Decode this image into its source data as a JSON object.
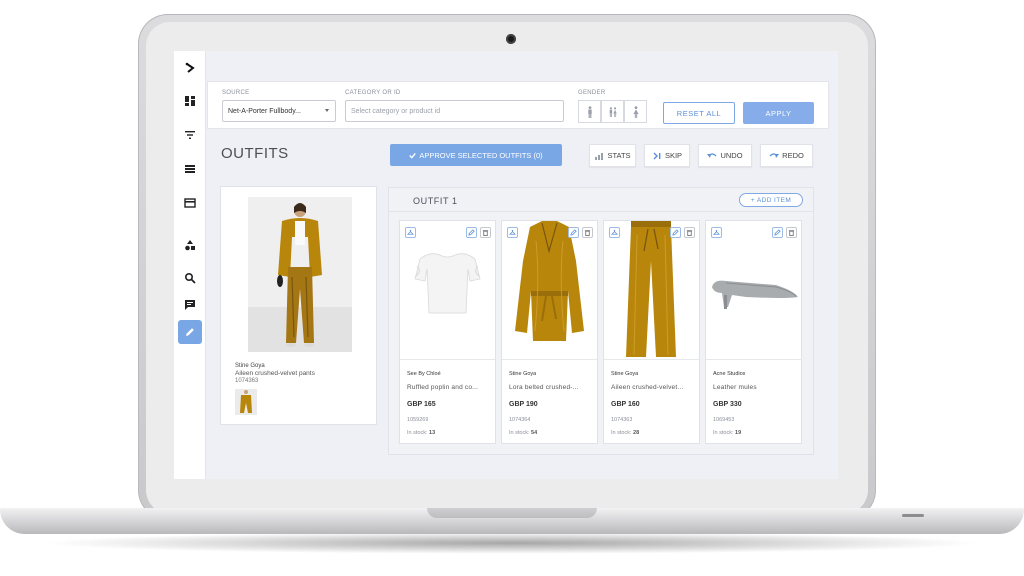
{
  "sidebar": {
    "items": [
      {
        "icon": "logo-icon"
      },
      {
        "icon": "dashboard-icon"
      },
      {
        "icon": "filter-icon"
      },
      {
        "icon": "list-icon"
      },
      {
        "icon": "card-icon"
      },
      {
        "icon": "shapes-icon"
      },
      {
        "icon": "search-icon"
      },
      {
        "icon": "comment-icon"
      },
      {
        "icon": "edit-icon",
        "active": true
      }
    ]
  },
  "filters": {
    "source_label": "SOURCE",
    "source_value": "Net-A-Porter Fullbody...",
    "category_label": "CATEGORY OR ID",
    "category_placeholder": "Select category or product id",
    "gender_label": "GENDER",
    "reset_label": "RESET ALL",
    "apply_label": "APPLY"
  },
  "header": {
    "title": "OUTFITS",
    "approve_label": "APPROVE SELECTED OUTFITS (0)",
    "stats_label": "STATS",
    "skip_label": "SKIP",
    "undo_label": "UNDO",
    "redo_label": "REDO"
  },
  "main_product": {
    "brand": "Stine Goya",
    "name": "Aileen crushed-velvet pants",
    "id": "1074363"
  },
  "outfit": {
    "title": "OUTFIT 1",
    "add_item_label": "+ ADD ITEM",
    "items": [
      {
        "brand": "See By Chloé",
        "name": "Ruffled poplin and co...",
        "price": "GBP 165",
        "id": "1059269",
        "stock_label": "In stock:",
        "stock": "13"
      },
      {
        "brand": "Stine Goya",
        "name": "Lora belted crushed-...",
        "price": "GBP 190",
        "id": "1074364",
        "stock_label": "In stock:",
        "stock": "54"
      },
      {
        "brand": "Stine Goya",
        "name": "Aileen crushed-velvet...",
        "price": "GBP 160",
        "id": "1074363",
        "stock_label": "In stock:",
        "stock": "28"
      },
      {
        "brand": "Acne Studios",
        "name": "Leather mules",
        "price": "GBP 330",
        "id": "1069453",
        "stock_label": "In stock:",
        "stock": "19"
      }
    ]
  },
  "colors": {
    "accent": "#79a7e6",
    "velvet": "#b8860b",
    "background": "#eef0f5"
  }
}
